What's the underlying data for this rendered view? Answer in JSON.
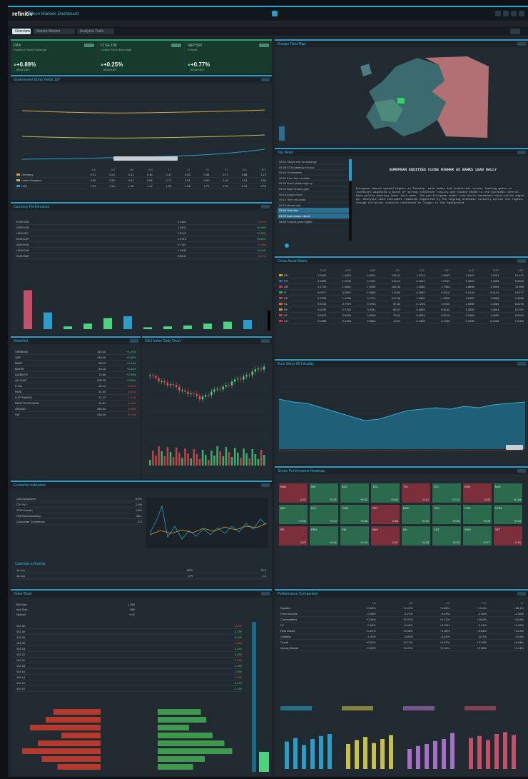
{
  "app": {
    "logo": "refinitiv",
    "title": "Eikon Markets Dashboard"
  },
  "tabs": [
    {
      "label": "Overview",
      "active": true
    },
    {
      "label": "Market Monitor",
      "active": false
    },
    {
      "label": "Analytics Tools",
      "active": false
    }
  ],
  "kpis": [
    {
      "name": "DAX",
      "sub": "Frankfurt Stock Exchange",
      "value": "+0.89%",
      "date": "09:42 CET"
    },
    {
      "name": "FTSE 100",
      "sub": "London Stock Exchange",
      "value": "+0.25%",
      "date": "09:42 CET"
    },
    {
      "name": "S&P 500",
      "sub": "Futures",
      "value": "+0.77%",
      "date": "09:42 CET"
    }
  ],
  "yield_panel": {
    "title": "Government Bond Yields 10Y",
    "table_headers": [
      "",
      "1W",
      "1M",
      "3M",
      "6M",
      "1Y",
      "2Y",
      "3Y",
      "5Y",
      "10Y",
      "30Y"
    ],
    "rows": [
      {
        "name": "Germany",
        "vals": [
          "0.21",
          "0.24",
          "0.31",
          "0.36",
          "0.41",
          "0.52",
          "0.58",
          "0.71",
          "0.88",
          "1.12"
        ]
      },
      {
        "name": "United Kingdom",
        "vals": [
          "0.52",
          "0.55",
          "0.61",
          "0.66",
          "0.72",
          "0.81",
          "0.90",
          "1.02",
          "1.24",
          "1.56"
        ]
      },
      {
        "name": "USA",
        "vals": [
          "1.32",
          "1.34",
          "1.40",
          "1.47",
          "1.55",
          "1.68",
          "1.79",
          "1.91",
          "2.14",
          "2.43"
        ]
      }
    ]
  },
  "fx_panel": {
    "title": "Currency Performance",
    "rows": [
      {
        "pair": "EUR/USD",
        "value": "1.1823",
        "chg": "-0.12%"
      },
      {
        "pair": "GBP/USD",
        "value": "1.3841",
        "chg": "+0.08%"
      },
      {
        "pair": "USD/JPY",
        "value": "110.21",
        "chg": "+0.22%"
      },
      {
        "pair": "EUR/CHF",
        "value": "1.0712",
        "chg": "+0.05%"
      },
      {
        "pair": "AUD/USD",
        "value": "0.7321",
        "chg": "-0.18%"
      },
      {
        "pair": "USD/CAD",
        "value": "1.2542",
        "chg": "+0.11%"
      },
      {
        "pair": "EUR/GBP",
        "value": "0.8541",
        "chg": "-0.07%"
      }
    ],
    "bar_values": [
      42,
      18,
      3,
      6,
      12,
      14,
      2,
      3,
      4,
      6,
      8,
      10
    ]
  },
  "watchlist": {
    "title": "Watchlist",
    "rows": [
      {
        "name": "SIEMENS",
        "last": "112.40",
        "chg": "+1.24%"
      },
      {
        "name": "SAP",
        "last": "118.06",
        "chg": "+0.86%"
      },
      {
        "name": "BASF",
        "last": "68.22",
        "chg": "+0.44%"
      },
      {
        "name": "BAYER",
        "last": "54.10",
        "chg": "+0.32%"
      },
      {
        "name": "DAIMLER",
        "last": "74.88",
        "chg": "+0.96%"
      },
      {
        "name": "ALLIANZ",
        "last": "208.35",
        "chg": "+0.58%"
      },
      {
        "name": "E.ON",
        "last": "10.12",
        "chg": "-0.42%"
      },
      {
        "name": "RWE",
        "last": "31.90",
        "chg": "-0.61%"
      },
      {
        "name": "LUFTHANSA",
        "last": "11.23",
        "chg": "-1.14%"
      },
      {
        "name": "DEUTSCHE BANK",
        "last": "10.84",
        "chg": "-0.92%"
      },
      {
        "name": "ADIDAS",
        "last": "289.60",
        "chg": "-0.38%"
      },
      {
        "name": "VW",
        "last": "218.40",
        "chg": "-0.74%"
      }
    ]
  },
  "candle_panel": {
    "title": "DAX Index Daily Chart"
  },
  "econ_panel": {
    "title": "Economic Indicators",
    "rows": [
      {
        "name": "Unemployment",
        "val": "5.9%"
      },
      {
        "name": "CPI YoY",
        "val": "2.3%"
      },
      {
        "name": "GDP Growth",
        "val": "1.8%"
      },
      {
        "name": "PMI Manufacturing",
        "val": "58.1"
      },
      {
        "name": "Consumer Confidence",
        "val": "-3.2"
      }
    ],
    "calendar_title": "Calendar of Events",
    "events": [
      {
        "date": "14 Jun",
        "event": "ZEW",
        "act": "79.8"
      },
      {
        "date": "15 Jun",
        "event": "CPI",
        "act": "2.5"
      }
    ]
  },
  "map_panel": {
    "title": "Europe Heat Map"
  },
  "news_panel": {
    "title": "Top News",
    "headline": "EUROPEAN EQUITIES CLOSE HIGHER AS BANKS LEAD RALLY",
    "items": [
      "09:41 Stocks rise on earnings",
      "09:38 ECB meeting in focus",
      "09:35 Oil steadies",
      "09:31 Euro firm vs dollar",
      "09:28 Bund yields edge up",
      "09:22 Bank shares gain",
      "09:18 Autos mixed",
      "09:14 Tech rebounds",
      "09:10 Miners slip",
      "09:06 Gold flat",
      "09:02 Asia closes mixed",
      "08:58 Futures point higher"
    ],
    "body": "European shares opened higher on Tuesday, with banks and industrial stocks leading gains as investors digested a batch of strong corporate results and looked ahead to the European Central Bank policy meeting later this week. The pan-European index rose while benchmark bond yields edged up. Analysts said sentiment remained supported by the ongoing economic recovery across the region, though inflation concerns continued to linger in the background."
  },
  "matrix_panel": {
    "title": "Cross Asset Matrix",
    "headers": [
      "",
      "EUR",
      "USD",
      "GBP",
      "JPY",
      "CHF",
      "CAD",
      "AUD",
      "NZD",
      "SEK"
    ],
    "rows": [
      [
        "DE",
        "1.0000",
        "1.1823",
        "0.8541",
        "130.21",
        "1.0712",
        "1.4823",
        "1.6142",
        "1.7021",
        "10.121"
      ],
      [
        "FR",
        "0.8458",
        "1.0000",
        "0.7224",
        "110.21",
        "0.9061",
        "1.2542",
        "1.3654",
        "1.4398",
        "8.5620"
      ],
      [
        "GB",
        "1.1709",
        "1.3841",
        "1.0000",
        "152.54",
        "1.2540",
        "1.7354",
        "1.8898",
        "1.9929",
        "11.850"
      ],
      [
        "IT",
        "0.0077",
        "0.0091",
        "0.0066",
        "1.0000",
        "0.0082",
        "0.0114",
        "0.0124",
        "0.0131",
        "0.0777"
      ],
      [
        "ES",
        "0.9335",
        "1.1036",
        "0.7974",
        "121.56",
        "1.0000",
        "1.3838",
        "1.5069",
        "1.5889",
        "9.4489"
      ],
      [
        "NL",
        "0.6746",
        "0.7973",
        "0.5762",
        "87.82",
        "0.7226",
        "1.0000",
        "1.0890",
        "1.1481",
        "6.8276"
      ],
      [
        "BE",
        "0.6195",
        "0.7324",
        "0.5291",
        "80.67",
        "0.6636",
        "0.9183",
        "1.0000",
        "1.0544",
        "6.2701"
      ],
      [
        "AT",
        "0.5875",
        "0.6945",
        "0.5018",
        "76.51",
        "0.6294",
        "0.8710",
        "0.9484",
        "1.0000",
        "5.9464"
      ],
      [
        "CH",
        "0.0988",
        "0.1168",
        "0.0844",
        "12.87",
        "0.1058",
        "0.1465",
        "0.1595",
        "0.1682",
        "1.0000"
      ]
    ]
  },
  "area_panel": {
    "title": "Euro Stoxx 50 Intraday"
  },
  "heat_panel": {
    "title": "Sector Performance Heatmap",
    "cells": [
      {
        "n": "BNK",
        "v": "-0.42",
        "c": "neg"
      },
      {
        "n": "INS",
        "v": "+0.31",
        "c": "pos"
      },
      {
        "n": "AUT",
        "v": "+0.82",
        "c": "pos"
      },
      {
        "n": "TEC",
        "v": "+0.54",
        "c": "pos"
      },
      {
        "n": "TEL",
        "v": "-0.12",
        "c": "neg"
      },
      {
        "n": "UTL",
        "v": "+0.21",
        "c": "pos"
      },
      {
        "n": "ENE",
        "v": "-0.33",
        "c": "neg"
      },
      {
        "n": "MAT",
        "v": "+0.18",
        "c": "pos"
      },
      {
        "n": "IND",
        "v": "+0.44",
        "c": "pos"
      },
      {
        "n": "HLT",
        "v": "+0.27",
        "c": "pos"
      },
      {
        "n": "CON",
        "v": "+0.36",
        "c": "pos"
      },
      {
        "n": "RET",
        "v": "-0.58",
        "c": "neg"
      },
      {
        "n": "MED",
        "v": "+0.12",
        "c": "pos"
      },
      {
        "n": "TRV",
        "v": "+0.63",
        "c": "pos"
      },
      {
        "n": "FOD",
        "v": "+0.09",
        "c": "pos"
      },
      {
        "n": "CHM",
        "v": "+0.15",
        "c": "pos"
      },
      {
        "n": "RE",
        "v": "-0.22",
        "c": "neg"
      },
      {
        "n": "PER",
        "v": "+0.41",
        "c": "pos"
      },
      {
        "n": "FIN",
        "v": "+0.19",
        "c": "pos"
      },
      {
        "n": "BAS",
        "v": "-0.47",
        "c": "neg"
      },
      {
        "n": "OIL",
        "v": "+0.28",
        "c": "pos"
      },
      {
        "n": "CST",
        "v": "+0.52",
        "c": "pos"
      },
      {
        "n": "SEM",
        "v": "+0.71",
        "c": "pos"
      },
      {
        "n": "SFT",
        "v": "-0.16",
        "c": "neg"
      }
    ]
  },
  "order_panel": {
    "title": "Order Book",
    "summary": [
      {
        "k": "Bid Size",
        "v": "1,250"
      },
      {
        "k": "Ask Size",
        "v": "980"
      },
      {
        "k": "Spread",
        "v": "0.02"
      }
    ],
    "book": [
      {
        "p": "112.32",
        "q": "3,200"
      },
      {
        "p": "112.30",
        "q": "2,750"
      },
      {
        "p": "112.28",
        "q": "4,100"
      },
      {
        "p": "112.26",
        "q": "1,980"
      },
      {
        "p": "112.24",
        "q": "2,410"
      },
      {
        "p": "112.22",
        "q": "3,650"
      },
      {
        "p": "112.20",
        "q": "5,020"
      },
      {
        "p": "112.18",
        "q": "1,340"
      },
      {
        "p": "112.16",
        "q": "2,890"
      },
      {
        "p": "112.14",
        "q": "3,110"
      },
      {
        "p": "112.12",
        "q": "4,470"
      },
      {
        "p": "112.10",
        "q": "2,230"
      }
    ],
    "depth_bid": [
      0.6,
      0.7,
      0.9,
      0.5,
      0.8,
      1.0,
      0.75,
      0.55
    ],
    "depth_ask": [
      0.55,
      0.62,
      0.4,
      0.7,
      0.85,
      0.95,
      0.6,
      0.45
    ]
  },
  "perf_panel": {
    "title": "Performance Comparison",
    "headers": [
      "",
      "1D",
      "1W",
      "1M",
      "YTD",
      "1Y"
    ],
    "rows": [
      [
        "Equities",
        "+0.62%",
        "+1.24%",
        "+2.86%",
        "+12.4%",
        "+28.1%"
      ],
      [
        "Fixed Income",
        "-0.08%",
        "-0.21%",
        "-0.44%",
        "-1.82%",
        "-2.36%"
      ],
      [
        "Commodities",
        "+0.34%",
        "+0.92%",
        "+3.12%",
        "+18.6%",
        "+42.8%"
      ],
      [
        "FX",
        "-0.05%",
        "+0.11%",
        "+0.28%",
        "-2.14%",
        "+3.42%"
      ],
      [
        "Real Estate",
        "+0.21%",
        "+0.48%",
        "+1.06%",
        "+6.84%",
        "+14.2%"
      ],
      [
        "Volatility",
        "-1.42%",
        "-3.84%",
        "-8.62%",
        "-22.1%",
        "-31.6%"
      ],
      [
        "Credit",
        "+0.04%",
        "+0.12%",
        "+0.41%",
        "+2.18%",
        "+5.64%"
      ],
      [
        "Money Market",
        "+0.00%",
        "+0.01%",
        "+0.02%",
        "+0.08%",
        "+0.14%"
      ]
    ],
    "mini_charts": [
      {
        "color": "#2a9ec8",
        "values": [
          0.55,
          0.62,
          0.48,
          0.6,
          0.66,
          0.7
        ]
      },
      {
        "color": "#c7c04a",
        "values": [
          0.5,
          0.58,
          0.64,
          0.52,
          0.6,
          0.68
        ]
      },
      {
        "color": "#a86fc9",
        "values": [
          0.4,
          0.46,
          0.5,
          0.56,
          0.6,
          0.72
        ]
      },
      {
        "color": "#c4506a",
        "values": [
          0.62,
          0.66,
          0.58,
          0.7,
          0.74,
          0.68
        ]
      }
    ]
  }
}
